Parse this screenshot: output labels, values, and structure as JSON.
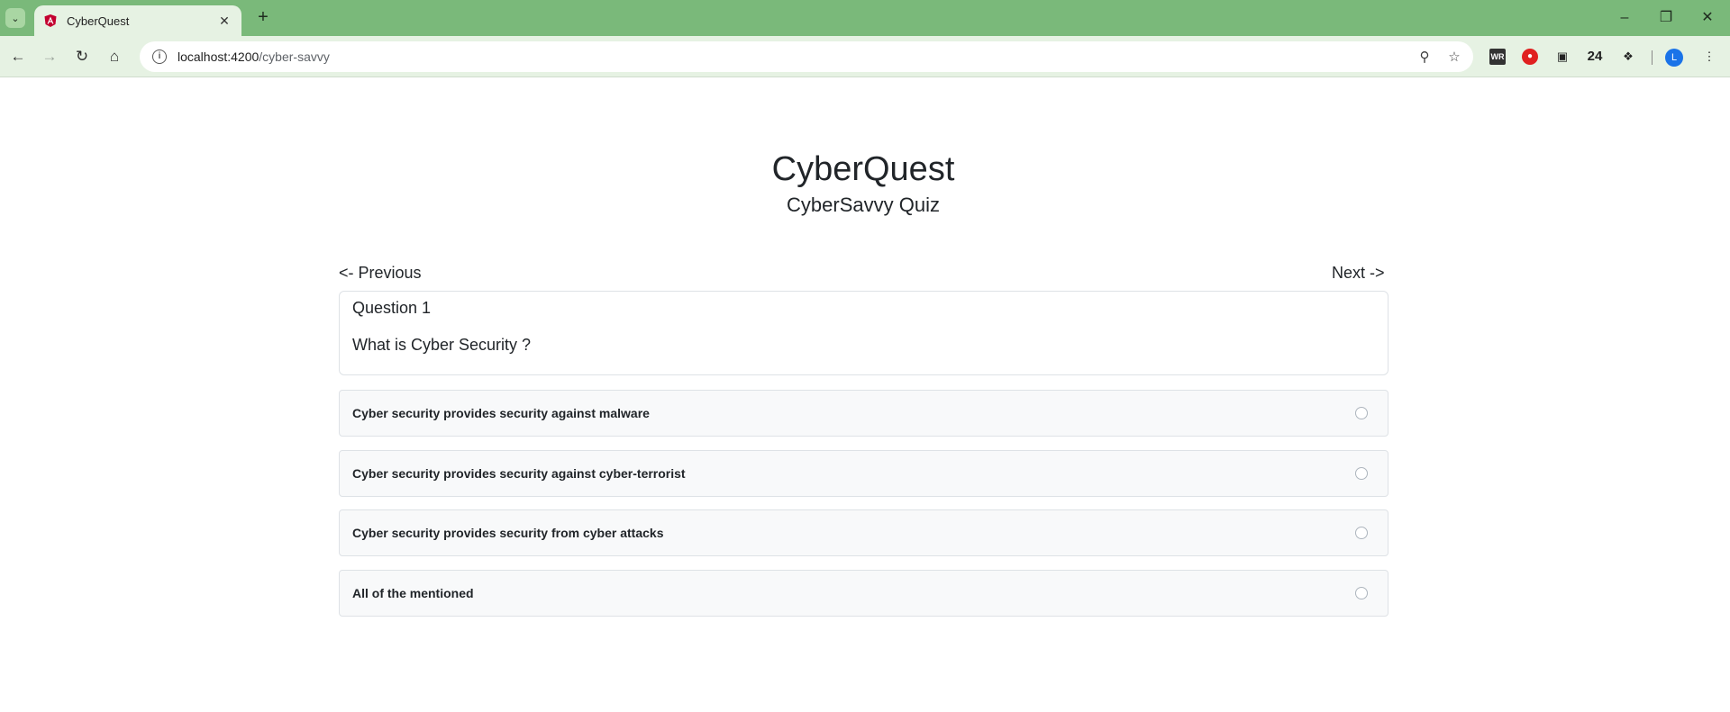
{
  "browser": {
    "tab_title": "CyberQuest",
    "url_host": "localhost:4200",
    "url_path": "/cyber-savvy",
    "extension_badge": "24",
    "extension_wr": "WR",
    "profile_initial": "L"
  },
  "header": {
    "title": "CyberQuest",
    "subtitle": "CyberSavvy Quiz"
  },
  "navigation": {
    "previous_label": "<- Previous",
    "next_label": "Next ->"
  },
  "question": {
    "number_label": "Question 1",
    "text": "What is Cyber Security ?"
  },
  "options": [
    {
      "label": "Cyber security provides security against malware",
      "selected": false
    },
    {
      "label": "Cyber security provides security against cyber-terrorist",
      "selected": false
    },
    {
      "label": "Cyber security provides security from cyber attacks",
      "selected": false
    },
    {
      "label": "All of the mentioned",
      "selected": false
    }
  ],
  "colors": {
    "tabbar": "#7ab97a",
    "toolbar": "#e6f2e3",
    "option_bg": "#f8f9fa",
    "border": "#dee2e6"
  }
}
